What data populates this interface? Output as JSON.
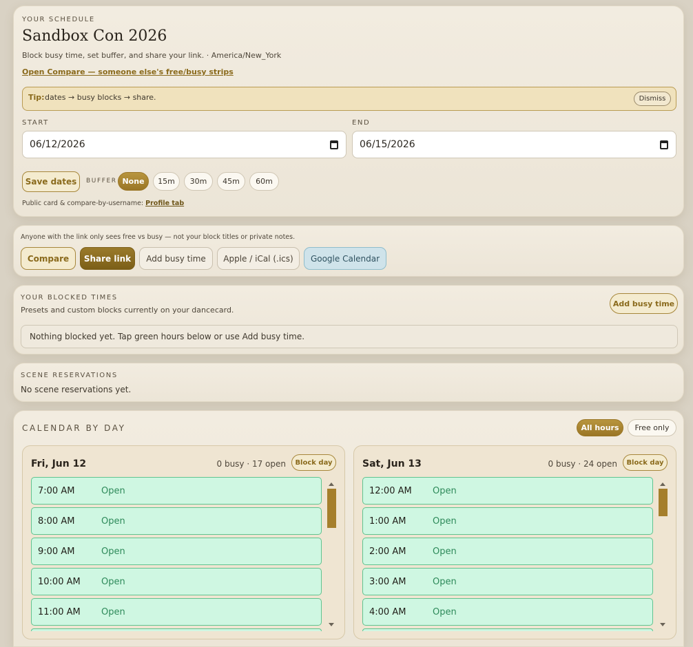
{
  "schedule": {
    "eyebrow": "YOUR SCHEDULE",
    "title": "Sandbox Con 2026",
    "subtitle": "Block busy time, set buffer, and share your link. · America/New_York",
    "compare_link": "Open Compare — someone else's free/busy strips",
    "tip_label": "Tip:",
    "tip_text": "dates → busy blocks → share.",
    "dismiss": "Dismiss",
    "start_label": "START",
    "start_value": "06/12/2026",
    "end_label": "END",
    "end_value": "06/15/2026",
    "save_dates": "Save dates",
    "buffer_label": "BUFFER",
    "buffer_options": [
      "None",
      "15m",
      "30m",
      "45m",
      "60m"
    ],
    "footer_text": "Public card & compare-by-username:",
    "footer_link": "Profile tab"
  },
  "share": {
    "note": "Anyone with the link only sees free vs busy — not your block titles or private notes.",
    "compare": "Compare",
    "share_link": "Share link",
    "add_busy": "Add busy time",
    "ical": "Apple / iCal (.ics)",
    "google": "Google Calendar"
  },
  "blocked": {
    "eyebrow": "YOUR BLOCKED TIMES",
    "subtitle": "Presets and custom blocks currently on your dancecard.",
    "add_busy": "Add busy time",
    "empty": "Nothing blocked yet. Tap green hours below or use Add busy time."
  },
  "scenes": {
    "eyebrow": "SCENE RESERVATIONS",
    "empty": "No scene reservations yet."
  },
  "calendar": {
    "eyebrow": "CALENDAR BY DAY",
    "all_hours": "All hours",
    "free_only": "Free only",
    "days": [
      {
        "label": "Fri, Jun 12",
        "summary": "0 busy · 17 open",
        "block_day": "Block day",
        "slots": [
          {
            "time": "7:00 AM",
            "status": "Open"
          },
          {
            "time": "8:00 AM",
            "status": "Open"
          },
          {
            "time": "9:00 AM",
            "status": "Open"
          },
          {
            "time": "10:00 AM",
            "status": "Open"
          },
          {
            "time": "11:00 AM",
            "status": "Open"
          }
        ]
      },
      {
        "label": "Sat, Jun 13",
        "summary": "0 busy · 24 open",
        "block_day": "Block day",
        "slots": [
          {
            "time": "12:00 AM",
            "status": "Open"
          },
          {
            "time": "1:00 AM",
            "status": "Open"
          },
          {
            "time": "2:00 AM",
            "status": "Open"
          },
          {
            "time": "3:00 AM",
            "status": "Open"
          },
          {
            "time": "4:00 AM",
            "status": "Open"
          }
        ]
      }
    ]
  },
  "colors": {
    "accent": "#9a7626",
    "open_slot": "#cff7e2",
    "open_text": "#2e8a5a",
    "google": "#cfe3ea"
  }
}
